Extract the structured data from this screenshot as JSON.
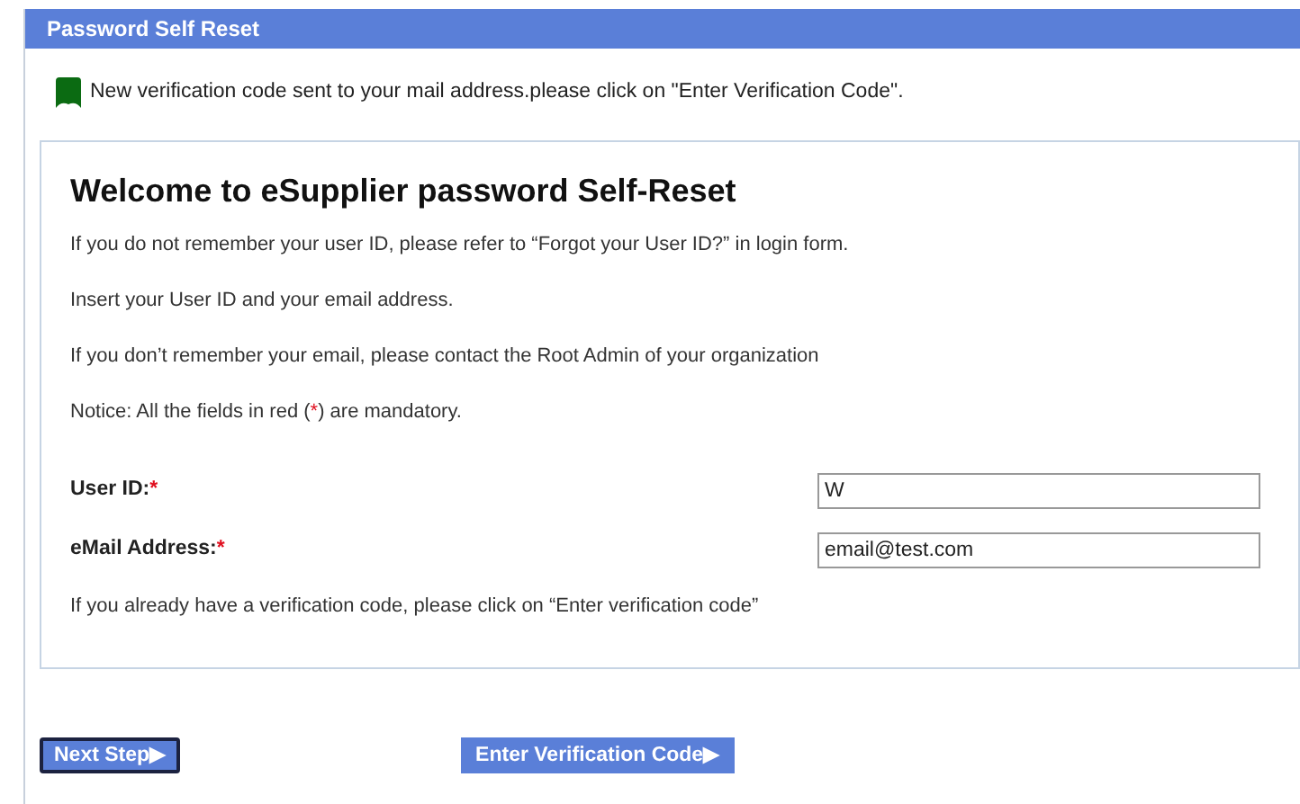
{
  "header": {
    "title": "Password Self Reset"
  },
  "message": {
    "text": "New verification code sent to your mail address.please click on \"Enter Verification Code\"."
  },
  "panel": {
    "title": "Welcome to eSupplier password Self-Reset",
    "paragraphs": [
      "If you do not remember your user ID, please refer to “Forgot your User ID?” in login form.",
      "Insert your User ID and your email address.",
      "If you don’t remember your email, please contact the Root Admin of your organization"
    ],
    "notice": {
      "before": "Notice: All the fields in red (",
      "mark": "*",
      "after": ") are mandatory."
    },
    "fields": [
      {
        "label": "User ID:",
        "required": true,
        "value": "W"
      },
      {
        "label": "eMail Address:",
        "required": true,
        "value": "email@test.com"
      }
    ],
    "footnote": "If you already have a verification code, please click on “Enter verification code”"
  },
  "buttons": [
    {
      "label": "Next Step",
      "arrow": "▶",
      "focused": true
    },
    {
      "label": "Enter Verification Code",
      "arrow": "▶",
      "focused": false
    }
  ]
}
